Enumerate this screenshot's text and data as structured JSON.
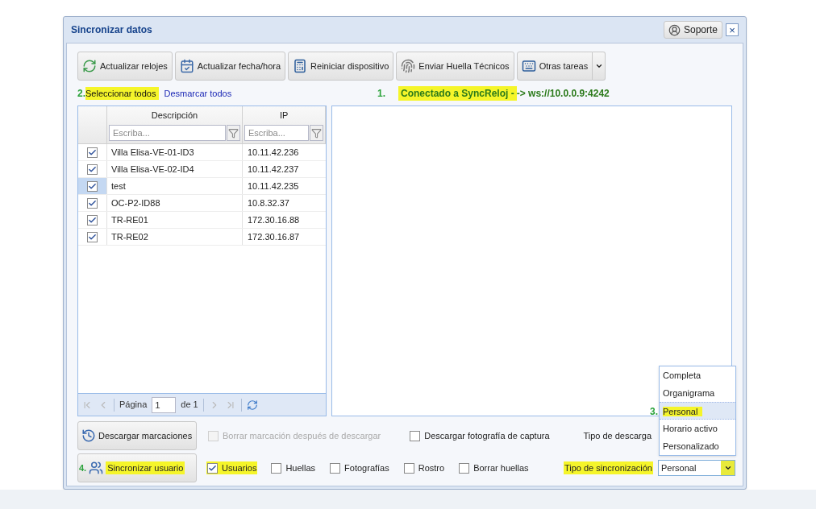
{
  "window": {
    "title": "Sincronizar datos",
    "support_button": "Soporte",
    "close_button": "×"
  },
  "toolbar": [
    {
      "label": "Actualizar relojes",
      "kind": "plain"
    },
    {
      "label": "Actualizar fecha/hora",
      "kind": "plain"
    },
    {
      "label": "Reiniciar dispositivo",
      "kind": "plain"
    },
    {
      "label": "Enviar Huella Técnicos",
      "kind": "plain"
    },
    {
      "label": "Otras tareas",
      "kind": "split"
    }
  ],
  "select_all": {
    "annotation": "2.",
    "label": "Seleccionar todos",
    "highlighted": true
  },
  "deselect_all": {
    "label": "Desmarcar todos"
  },
  "connection": {
    "annotation": "1.",
    "status": "Conectado a SyncReloj -",
    "address": "-> ws://10.0.0.9:4242",
    "highlighted": true
  },
  "grid": {
    "columns": [
      {
        "label": "Descripción",
        "placeholder": "Escriba..."
      },
      {
        "label": "IP",
        "placeholder": "Escriba..."
      }
    ],
    "rows": [
      {
        "checked": true,
        "selected": false,
        "description": "Villa Elisa-VE-01-ID3",
        "ip": "10.11.42.236"
      },
      {
        "checked": true,
        "selected": false,
        "description": "Villa Elisa-VE-02-ID4",
        "ip": "10.11.42.237"
      },
      {
        "checked": true,
        "selected": true,
        "description": "test",
        "ip": "10.11.42.235"
      },
      {
        "checked": true,
        "selected": false,
        "description": "OC-P2-ID88",
        "ip": "10.8.32.37"
      },
      {
        "checked": true,
        "selected": false,
        "description": "TR-RE01",
        "ip": "172.30.16.88"
      },
      {
        "checked": true,
        "selected": false,
        "description": "TR-RE02",
        "ip": "172.30.16.87"
      }
    ],
    "pager": {
      "page_label": "Página",
      "page": "1",
      "of": "de 1"
    }
  },
  "download_row": {
    "button": "Descargar marcaciones",
    "options": [
      {
        "label": "Borrar marcación después de descargar",
        "checked": false,
        "disabled": true,
        "highlighted": false
      },
      {
        "label": "Descargar fotografía de captura",
        "checked": false,
        "disabled": false,
        "highlighted": false
      }
    ],
    "type_label": "Tipo de descarga"
  },
  "sync_row": {
    "annotation": "4.",
    "button": "Sincronizar usuario",
    "button_highlighted": true,
    "options": [
      {
        "label": "Usuarios",
        "checked": true,
        "disabled": false,
        "highlighted": true
      },
      {
        "label": "Huellas",
        "checked": false,
        "disabled": false,
        "highlighted": false
      },
      {
        "label": "Fotografías",
        "checked": false,
        "disabled": false,
        "highlighted": false
      },
      {
        "label": "Rostro",
        "checked": false,
        "disabled": false,
        "highlighted": false
      },
      {
        "label": "Borrar huellas",
        "checked": false,
        "disabled": false,
        "highlighted": false
      }
    ],
    "type_label": "Tipo de sincronización",
    "type_highlighted": true,
    "value": "Personal",
    "expanded": true
  },
  "dropdown": {
    "options": [
      {
        "label": "Completa",
        "selected": false,
        "highlighted": false
      },
      {
        "label": "Organigrama",
        "selected": false,
        "highlighted": false
      },
      {
        "label": "Personal",
        "selected": true,
        "highlighted": true,
        "annotation": "3."
      },
      {
        "label": "Horario activo",
        "selected": false,
        "highlighted": false
      },
      {
        "label": "Personalizado",
        "selected": false,
        "highlighted": false
      }
    ]
  }
}
